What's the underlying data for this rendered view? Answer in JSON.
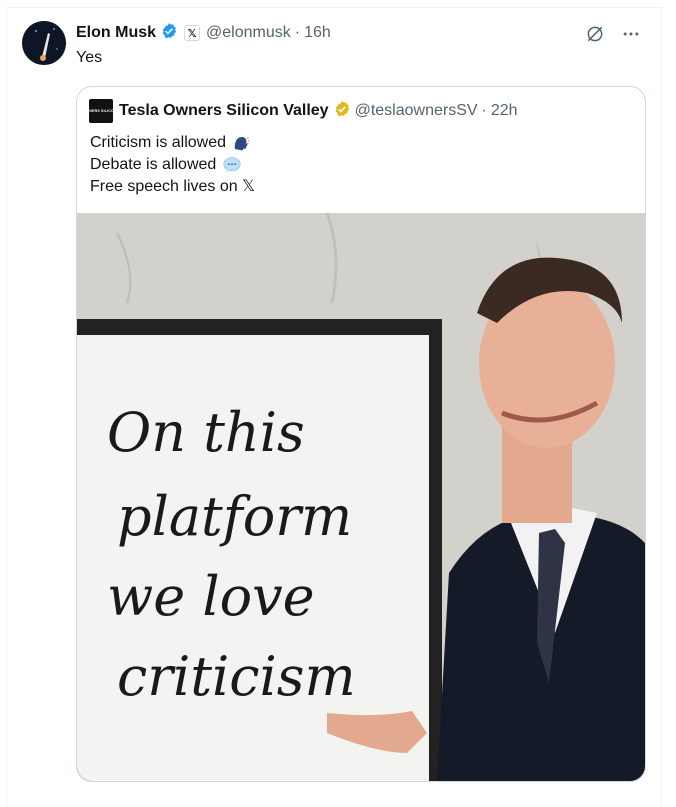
{
  "tweet": {
    "author_name": "Elon Musk",
    "handle": "@elonmusk",
    "dot": "·",
    "time": "16h",
    "x_badge": "𝕏",
    "text": "Yes"
  },
  "quoted": {
    "avatar_text": "TESLA OWNERS SILICON VALLEY",
    "author_name": "Tesla Owners Silicon Valley",
    "handle": "@teslaownersSV",
    "dot": "·",
    "time": "22h",
    "lines": [
      {
        "text": "Criticism is allowed",
        "emoji": "speaking-head-icon"
      },
      {
        "text": "Debate is allowed",
        "emoji": "speech-balloon-icon"
      },
      {
        "text": "Free speech lives on 𝕏",
        "emoji": ""
      }
    ],
    "image": {
      "whiteboard_lines": [
        "On this",
        "platform",
        "we love",
        "criticism"
      ]
    }
  },
  "colors": {
    "verified_blue": "#1d9bf0",
    "verified_gold": "#e2b719",
    "muted": "#536471"
  }
}
